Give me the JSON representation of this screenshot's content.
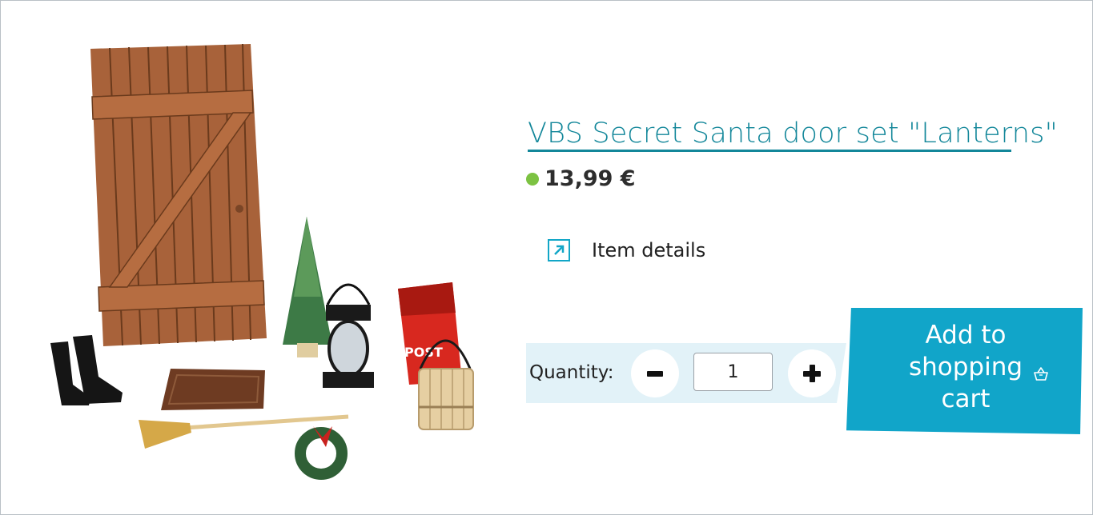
{
  "product": {
    "title": "VBS Secret Santa door set \"Lanterns\"",
    "price": "13,99 €",
    "availability_color": "#7cc242",
    "details_label": "Item details",
    "image_alt": "Secret Santa door set with wooden door, boots, doormat, broom, tree, lantern, wreath, post box and wooden bucket"
  },
  "cart": {
    "quantity_label": "Quantity:",
    "quantity_value": "1",
    "add_to_cart_label": "Add to shopping cart",
    "decrease_icon": "minus-icon",
    "increase_icon": "plus-icon",
    "cart_icon": "basket-icon"
  },
  "theme": {
    "accent": "#13879a",
    "cart_button": "#11a5c9",
    "quantity_band": "#e2f2f8"
  }
}
